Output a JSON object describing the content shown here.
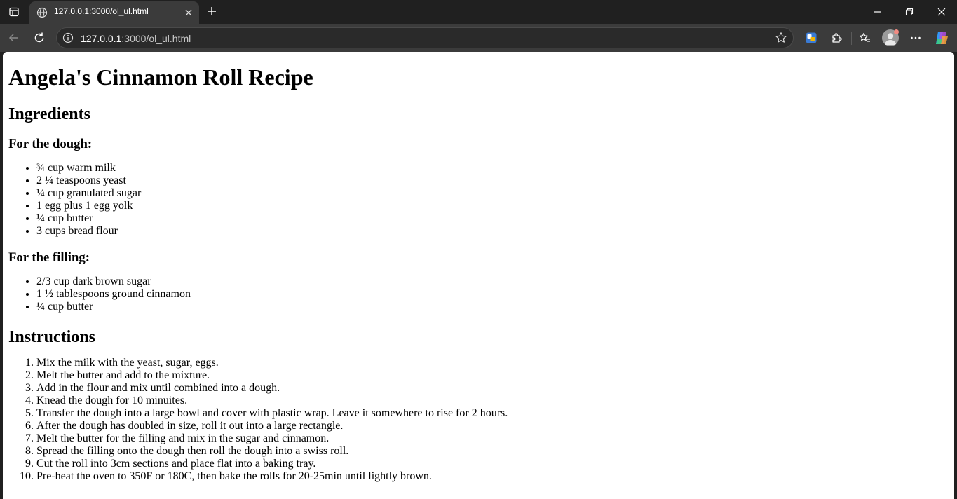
{
  "browser": {
    "tab": {
      "title": "127.0.0.1:3000/ol_ul.html"
    },
    "url": {
      "host": "127.0.0.1",
      "rest": ":3000/ol_ul.html"
    }
  },
  "page": {
    "title": "Angela's Cinnamon Roll Recipe",
    "ingredients": {
      "heading": "Ingredients",
      "dough": {
        "heading": "For the dough:",
        "items": [
          "¾ cup warm milk",
          "2 ¼ teaspoons yeast",
          "¼ cup granulated sugar",
          "1 egg plus 1 egg yolk",
          "¼ cup butter",
          "3 cups bread flour"
        ]
      },
      "filling": {
        "heading": "For the filling:",
        "items": [
          "2/3 cup dark brown sugar",
          "1 ½ tablespoons ground cinnamon",
          "¼ cup butter"
        ]
      }
    },
    "instructions": {
      "heading": "Instructions",
      "steps": [
        "Mix the milk with the yeast, sugar, eggs.",
        "Melt the butter and add to the mixture.",
        "Add in the flour and mix until combined into a dough.",
        "Knead the dough for 10 minuites.",
        "Transfer the dough into a large bowl and cover with plastic wrap. Leave it somewhere to rise for 2 hours.",
        "After the dough has doubled in size, roll it out into a large rectangle.",
        "Melt the butter for the filling and mix in the sugar and cinnamon.",
        "Spread the filling onto the dough then roll the dough into a swiss roll.",
        "Cut the roll into 3cm sections and place flat into a baking tray.",
        "Pre-heat the oven to 350F or 180C, then bake the rolls for 20-25min until lightly brown."
      ]
    }
  }
}
